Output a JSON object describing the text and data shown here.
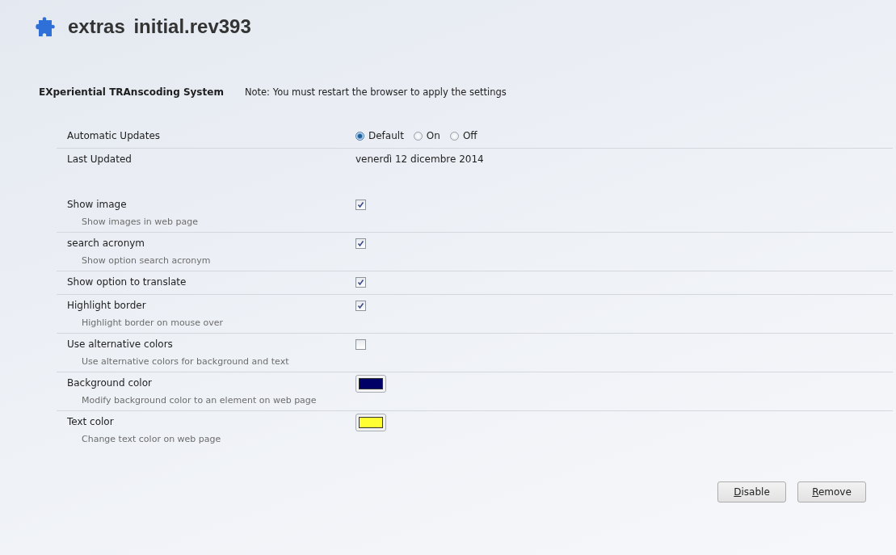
{
  "title": "extras initial.rev393",
  "section": {
    "name": "EXperiential TRAnscoding System",
    "note": "Note: You must restart the browser to apply the settings"
  },
  "settings": [
    {
      "kind": "radio",
      "label": "Automatic Updates",
      "options": [
        {
          "label": "Default",
          "selected": true
        },
        {
          "label": "On",
          "selected": false
        },
        {
          "label": "Off",
          "selected": false
        }
      ]
    },
    {
      "kind": "text",
      "label": "Last Updated",
      "value": "venerdì 12 dicembre 2014"
    },
    {
      "kind": "checkbox",
      "label": "Show image",
      "description": "Show images in web page",
      "checked": true
    },
    {
      "kind": "checkbox",
      "label": "search acronym",
      "description": "Show option search acronym",
      "checked": true
    },
    {
      "kind": "checkbox",
      "label": "Show option to translate",
      "checked": true
    },
    {
      "kind": "checkbox",
      "label": "Highlight border",
      "description": "Highlight border on mouse over",
      "checked": true
    },
    {
      "kind": "checkbox",
      "label": "Use alternative colors",
      "description": "Use alternative colors for background and text",
      "checked": false
    },
    {
      "kind": "color",
      "label": "Background color",
      "description": "Modify background color to an  element on web page",
      "color": "#000066"
    },
    {
      "kind": "color",
      "label": "Text color",
      "description": "Change text color on web page",
      "color": "#ffff33"
    }
  ],
  "buttons": [
    {
      "access_key": "D",
      "rest": "isable"
    },
    {
      "access_key": "R",
      "rest": "emove"
    }
  ]
}
